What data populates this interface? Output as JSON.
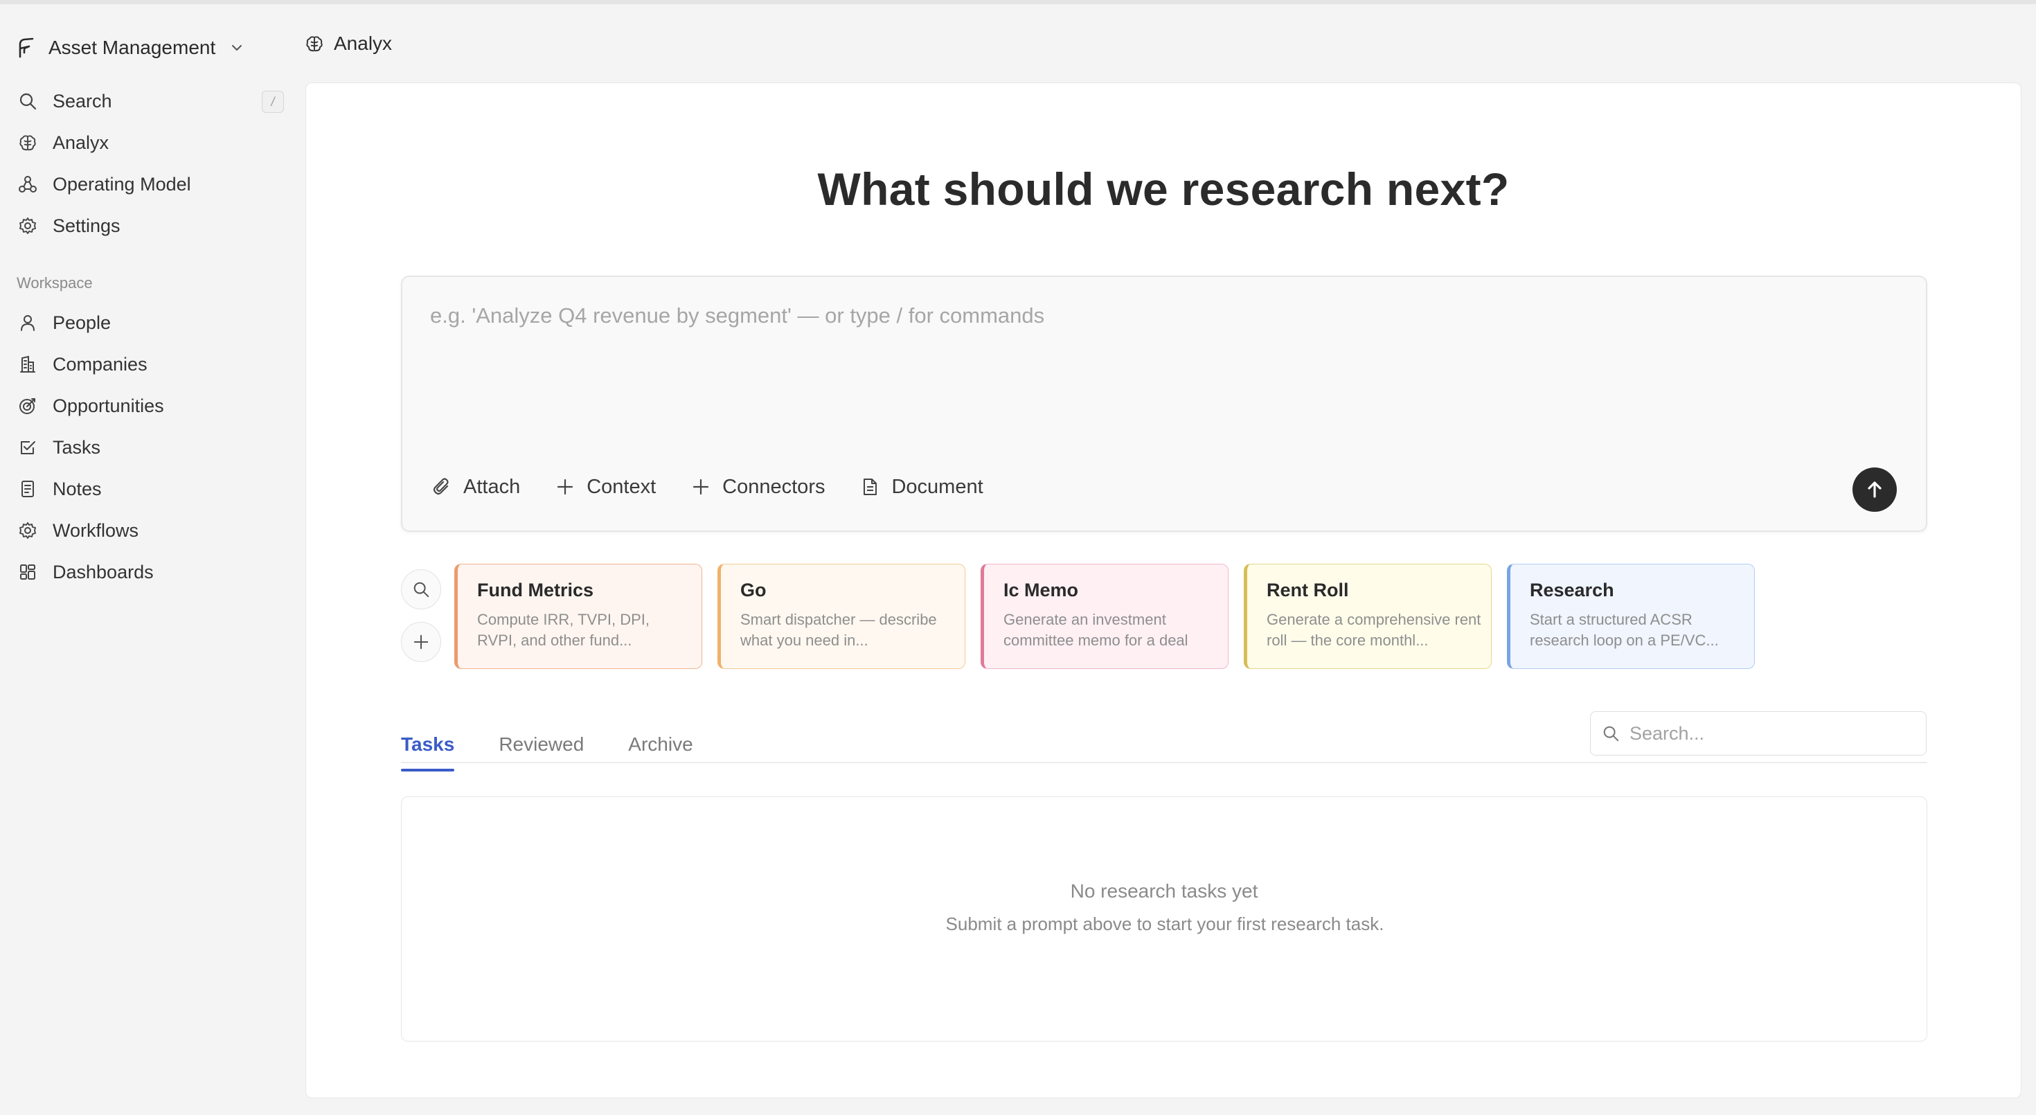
{
  "workspace": {
    "name": "Asset Management"
  },
  "breadcrumb": {
    "label": "Analyx"
  },
  "nav_primary": [
    {
      "label": "Search",
      "icon": "search-icon",
      "shortcut": "/"
    },
    {
      "label": "Analyx",
      "icon": "brain-icon"
    },
    {
      "label": "Operating Model",
      "icon": "nodes-icon"
    },
    {
      "label": "Settings",
      "icon": "gear-icon"
    }
  ],
  "workspace_section": {
    "label": "Workspace"
  },
  "nav_workspace": [
    {
      "label": "People",
      "icon": "person-icon"
    },
    {
      "label": "Companies",
      "icon": "building-icon"
    },
    {
      "label": "Opportunities",
      "icon": "target-icon"
    },
    {
      "label": "Tasks",
      "icon": "checkbox-icon"
    },
    {
      "label": "Notes",
      "icon": "note-icon"
    },
    {
      "label": "Workflows",
      "icon": "workflow-gear-icon"
    },
    {
      "label": "Dashboards",
      "icon": "dashboard-icon"
    }
  ],
  "main": {
    "heading": "What should we research next?",
    "composer": {
      "placeholder": "e.g. 'Analyze Q4 revenue by segment' — or type / for commands",
      "value": "",
      "tools": [
        {
          "label": "Attach",
          "icon": "paperclip-icon"
        },
        {
          "label": "Context",
          "icon": "plus-icon"
        },
        {
          "label": "Connectors",
          "icon": "plus-icon"
        },
        {
          "label": "Document",
          "icon": "document-icon"
        }
      ],
      "send_icon": "arrow-up-icon"
    },
    "skills": [
      {
        "title": "Fund Metrics",
        "desc": "Compute IRR, TVPI, DPI, RVPI, and other fund...",
        "border": "#f0b48e",
        "accent": "#ee9a6a",
        "bg": "#fff5f0"
      },
      {
        "title": "Go",
        "desc": "Smart dispatcher — describe what you need in...",
        "border": "#f3cc96",
        "accent": "#eeb267",
        "bg": "#fff8f0"
      },
      {
        "title": "Ic Memo",
        "desc": "Generate an investment committee memo for a deal",
        "border": "#f1b7c8",
        "accent": "#df7a9a",
        "bg": "#fff0f4"
      },
      {
        "title": "Rent Roll",
        "desc": "Generate a comprehensive rent roll — the core monthl...",
        "border": "#e6d68e",
        "accent": "#d7bd56",
        "bg": "#fffdea"
      },
      {
        "title": "Research",
        "desc": "Start a structured ACSR research loop on a PE/VC...",
        "border": "#b4cdf1",
        "accent": "#7aa3e5",
        "bg": "#f0f5fe"
      }
    ],
    "tabs": [
      {
        "label": "Tasks",
        "active": true
      },
      {
        "label": "Reviewed",
        "active": false
      },
      {
        "label": "Archive",
        "active": false
      }
    ],
    "task_search": {
      "placeholder": "Search...",
      "value": ""
    },
    "empty_state": {
      "title": "No research tasks yet",
      "subtitle": "Submit a prompt above to start your first research task."
    }
  }
}
